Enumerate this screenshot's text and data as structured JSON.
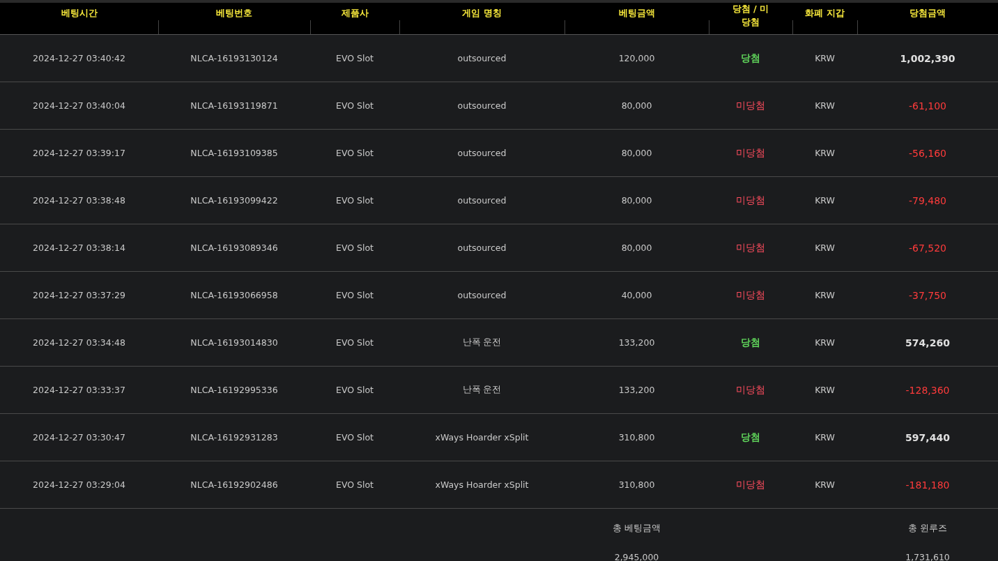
{
  "columns": [
    "베팅시간",
    "베팅번호",
    "제품사",
    "게임 명칭",
    "베팅금액",
    "당첨 / 미당첨",
    "화폐 지갑",
    "당첨금액"
  ],
  "rows": [
    {
      "time": "2024-12-27 03:40:42",
      "bet_id": "NLCA-16193130124",
      "provider": "EVO Slot",
      "game": "outsourced",
      "bet_amount": "120,000",
      "result": {
        "kind": "win",
        "label": "당첨"
      },
      "currency": "KRW",
      "payout": "1,002,390"
    },
    {
      "time": "2024-12-27 03:40:04",
      "bet_id": "NLCA-16193119871",
      "provider": "EVO Slot",
      "game": "outsourced",
      "bet_amount": "80,000",
      "result": {
        "kind": "lose",
        "label": "미당첨"
      },
      "currency": "KRW",
      "payout": "-61,100"
    },
    {
      "time": "2024-12-27 03:39:17",
      "bet_id": "NLCA-16193109385",
      "provider": "EVO Slot",
      "game": "outsourced",
      "bet_amount": "80,000",
      "result": {
        "kind": "lose",
        "label": "미당첨"
      },
      "currency": "KRW",
      "payout": "-56,160"
    },
    {
      "time": "2024-12-27 03:38:48",
      "bet_id": "NLCA-16193099422",
      "provider": "EVO Slot",
      "game": "outsourced",
      "bet_amount": "80,000",
      "result": {
        "kind": "lose",
        "label": "미당첨"
      },
      "currency": "KRW",
      "payout": "-79,480"
    },
    {
      "time": "2024-12-27 03:38:14",
      "bet_id": "NLCA-16193089346",
      "provider": "EVO Slot",
      "game": "outsourced",
      "bet_amount": "80,000",
      "result": {
        "kind": "lose",
        "label": "미당첨"
      },
      "currency": "KRW",
      "payout": "-67,520"
    },
    {
      "time": "2024-12-27 03:37:29",
      "bet_id": "NLCA-16193066958",
      "provider": "EVO Slot",
      "game": "outsourced",
      "bet_amount": "40,000",
      "result": {
        "kind": "lose",
        "label": "미당첨"
      },
      "currency": "KRW",
      "payout": "-37,750"
    },
    {
      "time": "2024-12-27 03:34:48",
      "bet_id": "NLCA-16193014830",
      "provider": "EVO Slot",
      "game": "난폭 운전",
      "bet_amount": "133,200",
      "result": {
        "kind": "win",
        "label": "당첨"
      },
      "currency": "KRW",
      "payout": "574,260"
    },
    {
      "time": "2024-12-27 03:33:37",
      "bet_id": "NLCA-16192995336",
      "provider": "EVO Slot",
      "game": "난폭 운전",
      "bet_amount": "133,200",
      "result": {
        "kind": "lose",
        "label": "미당첨"
      },
      "currency": "KRW",
      "payout": "-128,360"
    },
    {
      "time": "2024-12-27 03:30:47",
      "bet_id": "NLCA-16192931283",
      "provider": "EVO Slot",
      "game": "xWays Hoarder xSplit",
      "bet_amount": "310,800",
      "result": {
        "kind": "win",
        "label": "당첨"
      },
      "currency": "KRW",
      "payout": "597,440"
    },
    {
      "time": "2024-12-27 03:29:04",
      "bet_id": "NLCA-16192902486",
      "provider": "EVO Slot",
      "game": "xWays Hoarder xSplit",
      "bet_amount": "310,800",
      "result": {
        "kind": "lose",
        "label": "미당첨"
      },
      "currency": "KRW",
      "payout": "-181,180"
    }
  ],
  "totals": {
    "bet_label": "총 베팅금액",
    "bet_value": "2,945,000",
    "winloss_label": "총 윈루즈",
    "winloss_value": "1,731,610"
  }
}
